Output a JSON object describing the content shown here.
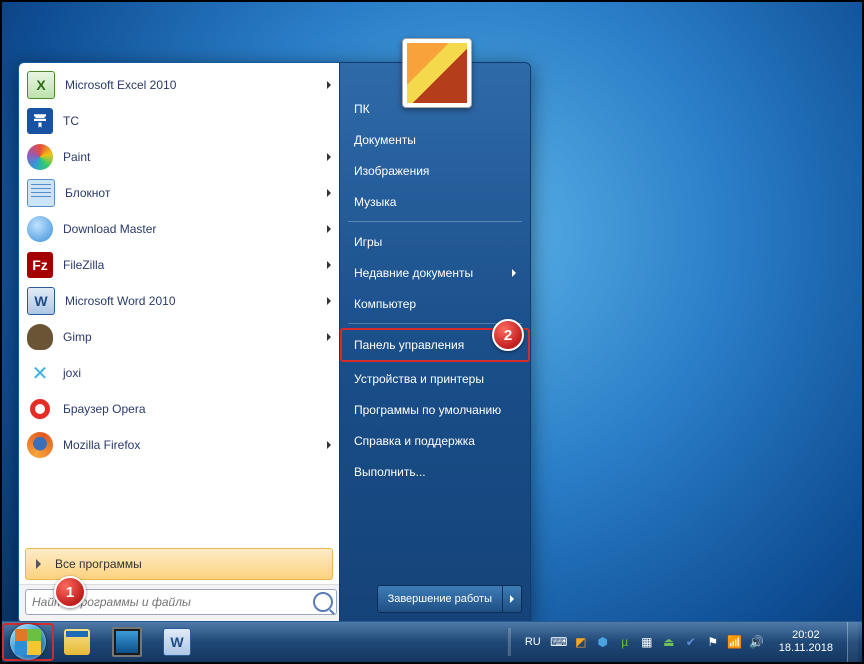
{
  "annotations": {
    "marker1": "1",
    "marker2": "2"
  },
  "start_menu": {
    "apps": [
      {
        "label": "Microsoft Excel 2010",
        "icon": "excel",
        "has_submenu": true
      },
      {
        "label": "TC",
        "icon": "tc",
        "has_submenu": false
      },
      {
        "label": "Paint",
        "icon": "paint",
        "has_submenu": true
      },
      {
        "label": "Блокнот",
        "icon": "notepad",
        "has_submenu": true
      },
      {
        "label": "Download Master",
        "icon": "dm",
        "has_submenu": true
      },
      {
        "label": "FileZilla",
        "icon": "fz",
        "has_submenu": true
      },
      {
        "label": "Microsoft Word 2010",
        "icon": "word",
        "has_submenu": true
      },
      {
        "label": "Gimp",
        "icon": "gimp",
        "has_submenu": true
      },
      {
        "label": "joxi",
        "icon": "joxi",
        "has_submenu": false
      },
      {
        "label": "Браузер Opera",
        "icon": "opera",
        "has_submenu": false
      },
      {
        "label": "Mozilla Firefox",
        "icon": "firefox",
        "has_submenu": true
      }
    ],
    "all_programs": "Все программы",
    "search_placeholder": "Найти программы и файлы",
    "right": [
      {
        "label": "ПК",
        "submenu": false
      },
      {
        "label": "Документы",
        "submenu": false
      },
      {
        "label": "Изображения",
        "submenu": false
      },
      {
        "label": "Музыка",
        "submenu": false
      },
      {
        "sep": true
      },
      {
        "label": "Игры",
        "submenu": false
      },
      {
        "label": "Недавние документы",
        "submenu": true
      },
      {
        "label": "Компьютер",
        "submenu": false
      },
      {
        "sep": true
      },
      {
        "label": "Панель управления",
        "submenu": false,
        "highlighted": true
      },
      {
        "label": "Устройства и принтеры",
        "submenu": false
      },
      {
        "label": "Программы по умолчанию",
        "submenu": false
      },
      {
        "label": "Справка и поддержка",
        "submenu": false
      },
      {
        "label": "Выполнить...",
        "submenu": false
      }
    ],
    "shutdown_label": "Завершение работы"
  },
  "taskbar": {
    "lang": "RU",
    "time": "20:02",
    "date": "18.11.2018",
    "tray_icons": [
      "keyboard",
      "a-orange",
      "u-blue",
      "utorrent",
      "apps",
      "safe-remove",
      "vk",
      "security",
      "network",
      "volume"
    ]
  }
}
